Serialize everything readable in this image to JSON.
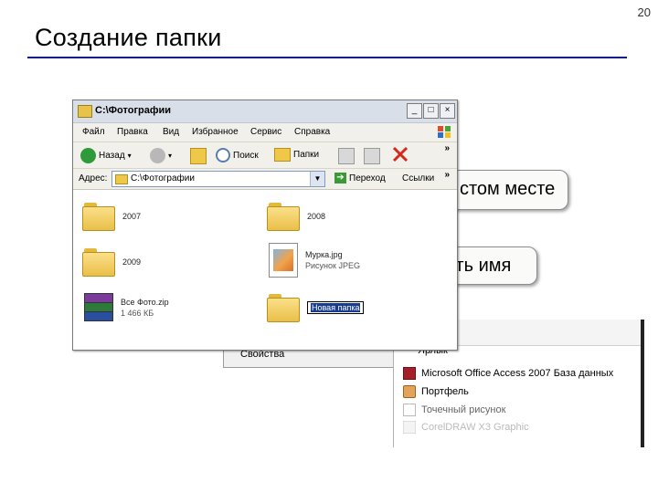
{
  "slide": {
    "number": "20",
    "title": "Создание папки"
  },
  "callouts": {
    "empty_place": "стом месте",
    "rename": "изменить имя"
  },
  "context_menu": {
    "properties": "Свойства"
  },
  "submenu": {
    "shortcut": "Ярлык",
    "items": [
      {
        "label": "Microsoft Office Access 2007 База данных",
        "icon": "access-icon"
      },
      {
        "label": "Портфель",
        "icon": "briefcase-icon"
      },
      {
        "label": "Точечный рисунок",
        "icon": "bitmap-icon"
      },
      {
        "label": "CorelDRAW X3 Graphic",
        "icon": "coreldraw-icon"
      }
    ]
  },
  "window": {
    "title": "C:\\Фотографии",
    "menu": [
      "Файл",
      "Правка",
      "Вид",
      "Избранное",
      "Сервис",
      "Справка"
    ],
    "toolbar": {
      "back": "Назад",
      "search": "Поиск",
      "folders": "Папки"
    },
    "address": {
      "label": "Адрес:",
      "value": "C:\\Фотографии",
      "go": "Переход",
      "links": "Ссылки"
    },
    "files": [
      {
        "name": "2007",
        "kind": "folder"
      },
      {
        "name": "2008",
        "kind": "folder"
      },
      {
        "name": "2009",
        "kind": "folder"
      },
      {
        "name": "Мурка.jpg",
        "sub": "Рисунок JPEG",
        "kind": "image"
      },
      {
        "name": "Все Фото.zip",
        "sub": "1 466 КБ",
        "kind": "zip"
      },
      {
        "name": "Новая папка",
        "kind": "folder-rename"
      }
    ]
  },
  "colors": {
    "title_rule": "#0a1a8c",
    "titlebar": "#d9dfe8",
    "chrome": "#f1f0ea",
    "rename_highlight": "#1a3c8c"
  }
}
